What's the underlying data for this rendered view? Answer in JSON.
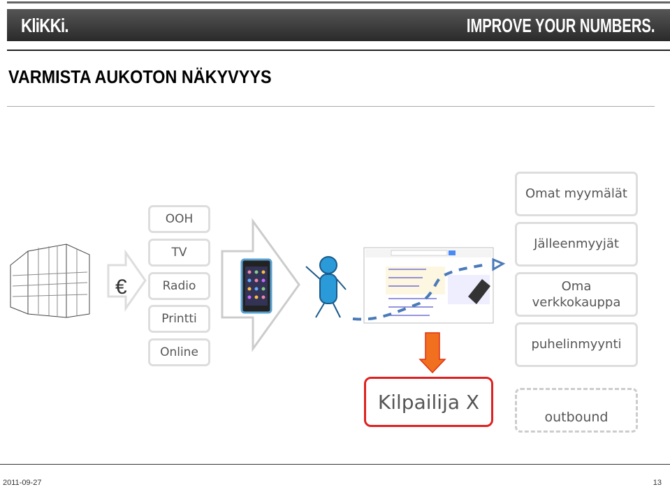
{
  "header": {
    "logo": "KliKKi.",
    "slogan": "IMPROVE YOUR NUMBERS."
  },
  "slide": {
    "title": "VARMISTA AUKOTON NÄKYVYYS",
    "currency_symbol": "€",
    "media": [
      "OOH",
      "TV",
      "Radio",
      "Printti",
      "Online"
    ],
    "channels": [
      "Omat myymälät",
      "Jälleenmyyjät",
      "Oma verkkokauppa",
      "puhelinmyynti"
    ],
    "competitor": "Kilpailija X",
    "outbound": "outbound",
    "colors": {
      "competitor_border": "#e02020",
      "arrow_down": "#f07020",
      "dashed_path": "#4a7ab8",
      "person": "#2a9ad8"
    }
  },
  "footer": {
    "date": "2011-09-27",
    "page": "13"
  }
}
